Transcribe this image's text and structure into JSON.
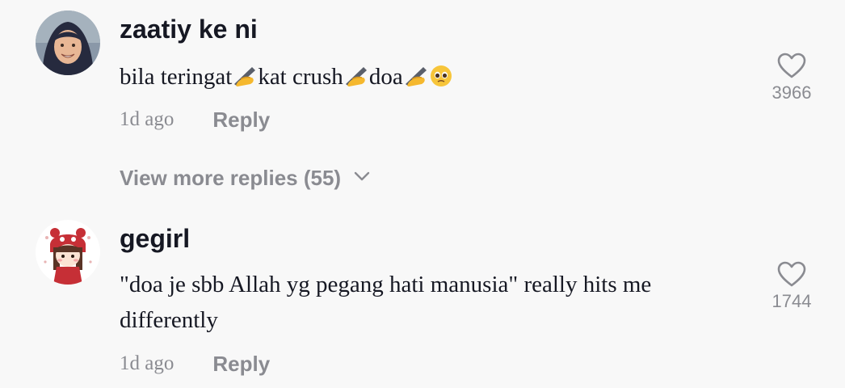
{
  "comments": [
    {
      "username": "zaatiy ke ni",
      "text_parts": [
        "bila teringat",
        "kat crush",
        "doa"
      ],
      "time": "1d ago",
      "reply_label": "Reply",
      "likes": "3966",
      "view_more": "View more replies (55)"
    },
    {
      "username": "gegirl",
      "text": "\"doa je sbb Allah yg pegang hati manusia\" really hits me differently",
      "time": "1d ago",
      "reply_label": "Reply",
      "likes": "1744"
    }
  ],
  "icons": {
    "like": "heart-outline-icon",
    "more": "chevron-down-icon",
    "writing_hand": "writing-hand-emoji",
    "pleading_face": "pleading-face-emoji"
  },
  "colors": {
    "background": "#f8f8f8",
    "primary_text": "#161823",
    "secondary_text": "#8a8b91",
    "icon": "#8a8b91"
  }
}
